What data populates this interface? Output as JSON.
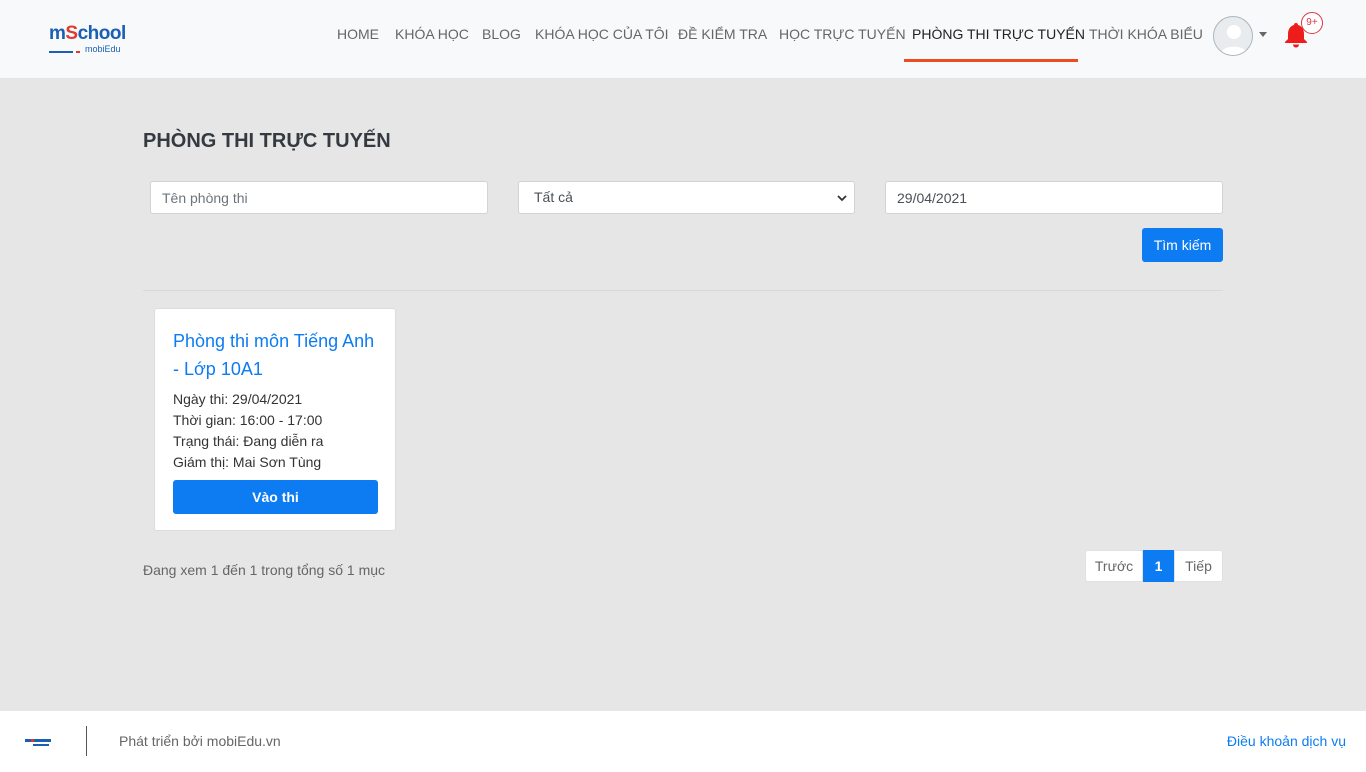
{
  "header": {
    "logo": {
      "brand_m": "m",
      "brand_s": "S",
      "brand_rest": "chool",
      "sub": "mobiEdu"
    },
    "nav": [
      {
        "label": "HOME"
      },
      {
        "label": "KHÓA HỌC"
      },
      {
        "label": "BLOG"
      },
      {
        "label": "KHÓA HỌC CỦA TÔI"
      },
      {
        "label": "ĐỀ KIỂM TRA"
      },
      {
        "label": "HỌC TRỰC TUYẾN"
      },
      {
        "label": "PHÒNG THI TRỰC TUYẾN",
        "active": true
      },
      {
        "label": "THỜI KHÓA BIỂU"
      }
    ],
    "notification_badge": "9+",
    "accent_color": "#ef4b23",
    "notification_color": "#dc3545"
  },
  "page": {
    "title": "PHÒNG THI TRỰC TUYẾN",
    "filters": {
      "name_placeholder": "Tên phòng thi",
      "name_value": "",
      "status_selected": "Tất cả",
      "date_value": "29/04/2021"
    },
    "search_label": "Tìm kiếm",
    "primary_color": "#0d7cf2"
  },
  "rooms": [
    {
      "title": "Phòng thi môn Tiếng Anh - Lớp 10A1",
      "date": "Ngày thi: 29/04/2021",
      "time": "Thời gian: 16:00 - 17:00",
      "status": "Trạng thái: Đang diễn ra",
      "proctor": "Giám thị: Mai Sơn Tùng",
      "button_label": "Vào thi"
    }
  ],
  "pagination": {
    "summary": "Đang xem 1 đến 1 trong tổng số 1 mục",
    "prev_label": "Trước",
    "current_page": "1",
    "next_label": "Tiếp"
  },
  "footer": {
    "developed_by": "Phát triển bởi mobiEdu.vn",
    "terms_link": "Điều khoản dịch vụ"
  }
}
